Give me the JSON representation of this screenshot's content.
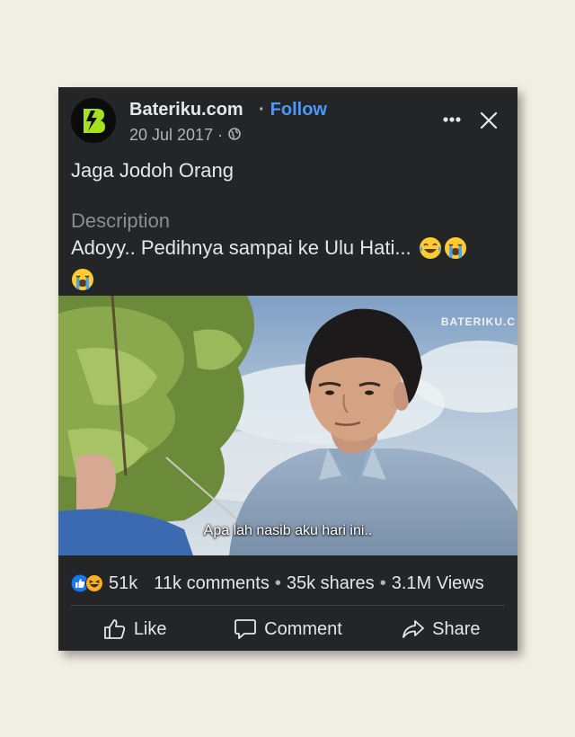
{
  "post": {
    "page_name": "Bateriku.com",
    "separator": "·",
    "follow_label": "Follow",
    "date": "20 Jul 2017 ·",
    "privacy_icon": "globe-icon",
    "title": "Jaga Jodoh Orang",
    "description_label": "Description",
    "description_text": "Adoyy.. Pedihnya sampai ke Ulu Hati...",
    "description_emojis": [
      "tears-of-joy-emoji",
      "loudly-crying-emoji",
      "loudly-crying-emoji"
    ]
  },
  "video": {
    "watermark": "BATERIKU.C",
    "subtitle": "Apa lah nasib aku hari ini.."
  },
  "stats": {
    "reactions": [
      "like-reaction-icon",
      "haha-reaction-icon"
    ],
    "reaction_count": "51k",
    "comments": "11k comments",
    "dot": "•",
    "shares": "35k shares",
    "views": "3.1M Views"
  },
  "actions": {
    "like_label": "Like",
    "comment_label": "Comment",
    "share_label": "Share"
  },
  "colors": {
    "card_bg": "#242526",
    "page_bg": "#f1eee3",
    "follow_blue": "#4599ff",
    "avatar_green": "#a5e021"
  }
}
